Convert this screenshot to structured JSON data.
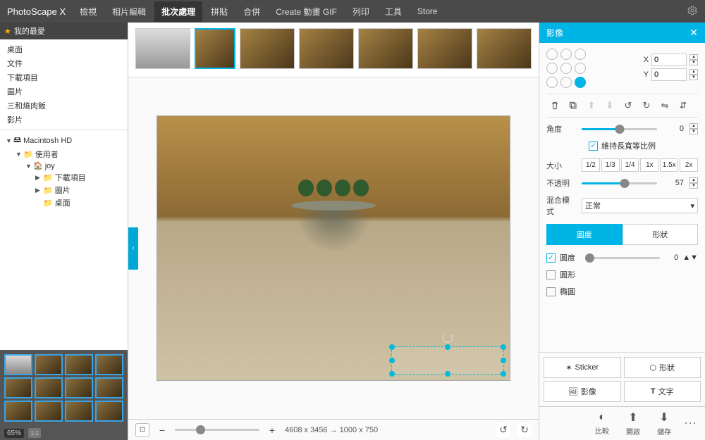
{
  "app": {
    "name": "PhotoScape X"
  },
  "menu": {
    "items": [
      "檢視",
      "相片編輯",
      "批次處理",
      "拼貼",
      "合併",
      "Create 動畫 GIF",
      "列印",
      "工具",
      "Store"
    ],
    "active_index": 2
  },
  "sidebar": {
    "favorites_label": "我的最愛",
    "nav_items": [
      "桌面",
      "文件",
      "下載項目",
      "圖片",
      "三和燒肉飯",
      "影片"
    ],
    "tree": {
      "root": "Macintosh HD",
      "l1": "使用者",
      "l2": "joy",
      "children": [
        "下載項目",
        "圖片",
        "桌面"
      ]
    },
    "zoom": {
      "value": "65%",
      "ratio": "1:1"
    }
  },
  "center": {
    "strip_count": 7,
    "strip_selected": 1,
    "status": {
      "dimensions": "4608 x 3456 → 1000 x 750"
    }
  },
  "panel": {
    "title": "影像",
    "x_label": "X",
    "y_label": "Y",
    "x_value": "0",
    "y_value": "0",
    "angle_label": "角度",
    "angle_value": "0",
    "keep_aspect": "維持長寬等比例",
    "size_label": "大小",
    "size_options": [
      "1/2",
      "1/3",
      "1/4",
      "1x",
      "1.5x",
      "2x"
    ],
    "opacity_label": "不透明",
    "opacity_value": "57",
    "blend_label": "混合模式",
    "blend_value": "正常",
    "tab_round": "圓度",
    "tab_shape": "形狀",
    "roundness_label": "圓度",
    "roundness_value": "0",
    "circle_label": "圓形",
    "ellipse_label": "橢圓"
  },
  "tools": {
    "sticker": "Sticker",
    "shape": "形狀",
    "image": "影像",
    "text": "文字"
  },
  "bottom": {
    "compare": "比較",
    "open": "開啟",
    "save": "儲存"
  }
}
